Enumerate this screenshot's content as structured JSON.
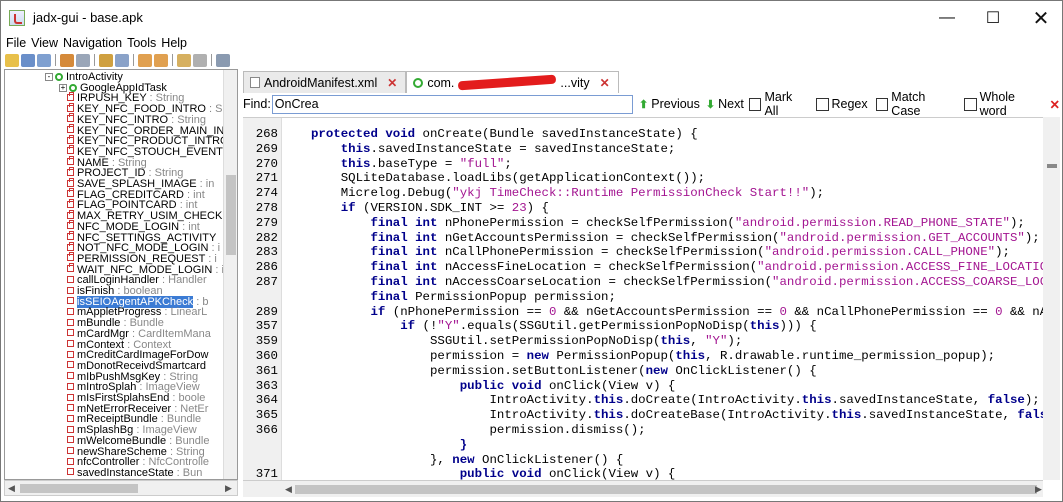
{
  "window": {
    "title": "jadx-gui - base.apk"
  },
  "menu": [
    "File",
    "View",
    "Navigation",
    "Tools",
    "Help"
  ],
  "tree": {
    "rows": [
      {
        "icon": "class",
        "label": "IntroActivity",
        "type": "",
        "indent": 40,
        "expander": "minus"
      },
      {
        "icon": "class",
        "label": "GoogleAppIdTask",
        "type": "",
        "indent": 54,
        "expander": "plus"
      },
      {
        "icon": "field-lock",
        "label": "IRPUSH_KEY",
        "type": " : String"
      },
      {
        "icon": "field-lock",
        "label": "KEY_NFC_FOOD_INTRO",
        "type": " : S"
      },
      {
        "icon": "field-lock",
        "label": "KEY_NFC_INTRO",
        "type": " : String"
      },
      {
        "icon": "field-lock",
        "label": "KEY_NFC_ORDER_MAIN_IN",
        "type": ""
      },
      {
        "icon": "field-lock",
        "label": "KEY_NFC_PRODUCT_INTRO",
        "type": ""
      },
      {
        "icon": "field-lock",
        "label": "KEY_NFC_STOUCH_EVENT",
        "type": ""
      },
      {
        "icon": "field-lock",
        "label": "NAME",
        "type": " : String"
      },
      {
        "icon": "field-lock",
        "label": "PROJECT_ID",
        "type": " : String"
      },
      {
        "icon": "field-lock",
        "label": "SAVE_SPLASH_IMAGE",
        "type": " : in"
      },
      {
        "icon": "field-lock",
        "label": "FLAG_CREDITCARD",
        "type": " : int"
      },
      {
        "icon": "field-lock",
        "label": "FLAG_POINTCARD",
        "type": " : int"
      },
      {
        "icon": "field-lock",
        "label": "MAX_RETRY_USIM_CHECK",
        "type": ""
      },
      {
        "icon": "field-lock",
        "label": "NFC_MODE_LOGIN",
        "type": " : int"
      },
      {
        "icon": "field-lock",
        "label": "NFC_SETTINGS_ACTIVITY",
        "type": ""
      },
      {
        "icon": "field-lock",
        "label": "NOT_NFC_MODE_LOGIN",
        "type": " : i"
      },
      {
        "icon": "field-lock",
        "label": "PERMISSION_REQUEST",
        "type": " : i"
      },
      {
        "icon": "field-lock",
        "label": "WAIT_NFC_MODE_LOGIN",
        "type": " : i"
      },
      {
        "icon": "field",
        "label": "callLoginHandler",
        "type": " : Handler"
      },
      {
        "icon": "field",
        "label": "isFinish",
        "type": " : boolean"
      },
      {
        "icon": "field",
        "label": "isSEIOAgentAPKCheck",
        "type": " : b",
        "selected": true
      },
      {
        "icon": "field",
        "label": "mAppletProgress",
        "type": " : LinearL"
      },
      {
        "icon": "field",
        "label": "mBundle",
        "type": " : Bundle"
      },
      {
        "icon": "field",
        "label": "mCardMgr",
        "type": " : CardItemMana"
      },
      {
        "icon": "field",
        "label": "mContext",
        "type": " : Context"
      },
      {
        "icon": "field",
        "label": "mCreditCardImageForDow",
        "type": ""
      },
      {
        "icon": "field",
        "label": "mDonotReceivdSmartcard",
        "type": ""
      },
      {
        "icon": "field",
        "label": "mIbPushMsgKey",
        "type": " : String"
      },
      {
        "icon": "field",
        "label": "mIntroSplah",
        "type": " : ImageView"
      },
      {
        "icon": "field",
        "label": "mIsFirstSplahsEnd",
        "type": " : boole"
      },
      {
        "icon": "field",
        "label": "mNetErrorReceiver",
        "type": " : NetEr"
      },
      {
        "icon": "field",
        "label": "mReceiptBundle",
        "type": " : Bundle"
      },
      {
        "icon": "field",
        "label": "mSplashBg",
        "type": " : ImageView"
      },
      {
        "icon": "field",
        "label": "mWelcomeBundle",
        "type": " : Bundle"
      },
      {
        "icon": "field",
        "label": "newShareScheme",
        "type": " : String"
      },
      {
        "icon": "field",
        "label": "nfcController",
        "type": " : NfcControlle"
      },
      {
        "icon": "field",
        "label": "savedInstanceState",
        "type": " : Bun"
      }
    ]
  },
  "tabs": [
    {
      "label": "AndroidManifest.xml",
      "icon": "xml-file",
      "active": false
    },
    {
      "label": "com.",
      "suffix": "...vity",
      "icon": "class",
      "active": true
    }
  ],
  "find": {
    "label": "Find:",
    "value": "OnCrea",
    "previous": "Previous",
    "next": "Next",
    "mark_all": "Mark All",
    "regex": "Regex",
    "match_case": "Match Case",
    "whole_word": "Whole word"
  },
  "code": [
    {
      "ln": "268",
      "html": "<span class='kw'>protected</span> <span class='kw'>void</span> onCreate(Bundle savedInstanceState) {"
    },
    {
      "ln": "269",
      "html": "    <span class='kw'>this</span>.savedInstanceState = savedInstanceState;"
    },
    {
      "ln": "270",
      "html": "    <span class='kw'>this</span>.baseType = <span class='str'>\"full\"</span>;"
    },
    {
      "ln": "271",
      "html": "    SQLiteDatabase.loadLibs(getApplicationContext());"
    },
    {
      "ln": "274",
      "html": "    Micrelog.Debug(<span class='str'>\"ykj TimeCheck::Runtime PermissionCheck Start!!\"</span>);"
    },
    {
      "ln": "278",
      "html": "    <span class='kw'>if</span> (VERSION.SDK_INT &gt;= <span class='num'>23</span>) {"
    },
    {
      "ln": "279",
      "html": "        <span class='kw'>final</span> <span class='kw'>int</span> nPhonePermission = checkSelfPermission(<span class='str'>\"android.permission.READ_PHONE_STATE\"</span>);"
    },
    {
      "ln": "282",
      "html": "        <span class='kw'>final</span> <span class='kw'>int</span> nGetAccountsPermission = checkSelfPermission(<span class='str'>\"android.permission.GET_ACCOUNTS\"</span>);"
    },
    {
      "ln": "283",
      "html": "        <span class='kw'>final</span> <span class='kw'>int</span> nCallPhonePermission = checkSelfPermission(<span class='str'>\"android.permission.CALL_PHONE\"</span>);"
    },
    {
      "ln": "286",
      "html": "        <span class='kw'>final</span> <span class='kw'>int</span> nAccessFineLocation = checkSelfPermission(<span class='str'>\"android.permission.ACCESS_FINE_LOCATIO</span>"
    },
    {
      "ln": "287",
      "html": "        <span class='kw'>final</span> <span class='kw'>int</span> nAccessCoarseLocation = checkSelfPermission(<span class='str'>\"android.permission.ACCESS_COARSE_LOC</span>"
    },
    {
      "ln": "",
      "html": "        <span class='kw'>final</span> PermissionPopup permission;"
    },
    {
      "ln": "289",
      "html": "        <span class='kw'>if</span> (nPhonePermission == <span class='num'>0</span> &amp;&amp; nGetAccountsPermission == <span class='num'>0</span> &amp;&amp; nCallPhonePermission == <span class='num'>0</span> &amp;&amp; nAc"
    },
    {
      "ln": "357",
      "html": "            <span class='kw'>if</span> (!<span class='str'>\"Y\"</span>.equals(SSGUtil.getPermissionPopNoDisp(<span class='kw'>this</span>))) {"
    },
    {
      "ln": "359",
      "html": "                SSGUtil.setPermissionPopNoDisp(<span class='kw'>this</span>, <span class='str'>\"Y\"</span>);"
    },
    {
      "ln": "360",
      "html": "                permission = <span class='kw'>new</span> PermissionPopup(<span class='kw'>this</span>, R.drawable.runtime_permission_popup);"
    },
    {
      "ln": "361",
      "html": "                permission.setButtonListener(<span class='kw'>new</span> OnClickListener() {"
    },
    {
      "ln": "363",
      "html": "                    <span class='kw'>public</span> <span class='kw'>void</span> onClick(View v) {"
    },
    {
      "ln": "364",
      "html": "                        IntroActivity.<span class='kw'>this</span>.doCreate(IntroActivity.<span class='kw'>this</span>.savedInstanceState, <span class='kw'>false</span>);"
    },
    {
      "ln": "365",
      "html": "                        IntroActivity.<span class='kw'>this</span>.doCreateBase(IntroActivity.<span class='kw'>this</span>.savedInstanceState, <span class='kw'>fals</span>"
    },
    {
      "ln": "366",
      "html": "                        permission.dismiss();"
    },
    {
      "ln": "",
      "html": "                    <span class='kw'>}</span>"
    },
    {
      "ln": "",
      "html": "                }, <span class='kw'>new</span> OnClickListener() {"
    },
    {
      "ln": "371",
      "html": "                    <span class='kw'>public</span> <span class='kw'>void</span> onClick(View v) {"
    }
  ]
}
